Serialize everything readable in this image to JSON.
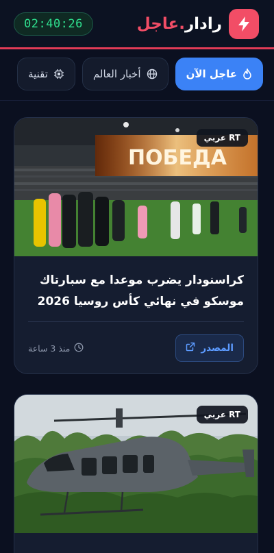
{
  "header": {
    "brand_main": "رادار",
    "brand_dot": ".",
    "brand_accent": "عاجل",
    "clock": "02:40:26",
    "logo_icon": "lightning-bolt-icon",
    "accent_color": "#f24d66",
    "clock_color": "#2fe08f"
  },
  "tabs": [
    {
      "label": "عاجل الآن",
      "icon": "flame-icon",
      "active": true
    },
    {
      "label": "أخبار العالم",
      "icon": "globe-icon",
      "active": false
    },
    {
      "label": "تقنية",
      "icon": "chip-icon",
      "active": false
    }
  ],
  "cards": [
    {
      "source": "RT عربي",
      "title": "كراسنودار يضرب موعدا مع سبارتاك موسكو في نهائي كأس روسيا 2026",
      "time": "منذ 3 ساعة",
      "source_button": "المصدر",
      "image_text": "ПОБЕДА"
    },
    {
      "source": "RT عربي",
      "title": "",
      "time": "",
      "source_button": ""
    }
  ]
}
